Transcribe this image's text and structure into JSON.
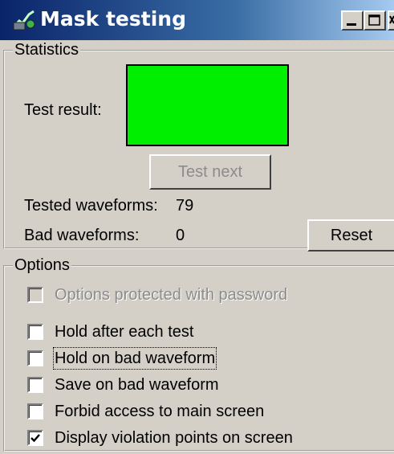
{
  "window": {
    "title": "Mask testing",
    "icon": "waveform-tool-icon"
  },
  "statistics": {
    "group_label": "Statistics",
    "test_result_label": "Test result:",
    "test_result_color": "#00ee00",
    "test_next_label": "Test next",
    "tested_label": "Tested waveforms:",
    "tested_value": "79",
    "bad_label": "Bad waveforms:",
    "bad_value": "0",
    "reset_label": "Reset"
  },
  "options": {
    "group_label": "Options",
    "items": [
      {
        "label": "Options protected with password",
        "checked": false,
        "enabled": false
      },
      {
        "label": "Hold after each test",
        "checked": false,
        "enabled": true
      },
      {
        "label": "Hold on bad waveform",
        "checked": false,
        "enabled": true
      },
      {
        "label": "Save on bad waveform",
        "checked": false,
        "enabled": true
      },
      {
        "label": "Forbid access to main screen",
        "checked": false,
        "enabled": true
      },
      {
        "label": "Display violation points on screen",
        "checked": true,
        "enabled": true
      }
    ]
  }
}
